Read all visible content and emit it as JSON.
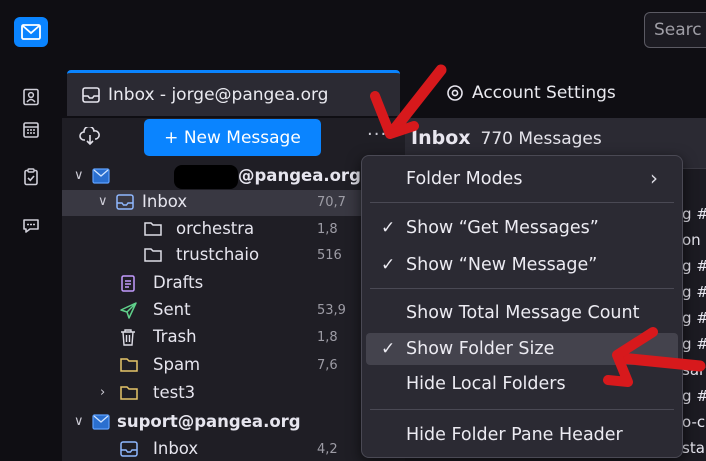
{
  "search": {
    "placeholder": "Searc"
  },
  "tabs": [
    {
      "label": "Inbox - jorge@pangea.org",
      "icon": "inbox-icon"
    },
    {
      "label": "Account Settings",
      "icon": "settings-gear-icon"
    }
  ],
  "folder_pane": {
    "new_message_label": "+ New Message",
    "menu_label": "···",
    "accounts": [
      {
        "name": "@pangea.org"
      },
      {
        "name": "suport@pangea.org"
      }
    ],
    "folders": [
      {
        "name": "Inbox",
        "size": "70,7"
      },
      {
        "name": "orchestra",
        "size": "1,8"
      },
      {
        "name": "trustchaio",
        "size": "516"
      },
      {
        "name": "Drafts",
        "size": ""
      },
      {
        "name": "Sent",
        "size": "53,9"
      },
      {
        "name": "Trash",
        "size": "1,8"
      },
      {
        "name": "Spam",
        "size": "7,6"
      },
      {
        "name": "test3",
        "size": ""
      },
      {
        "name": "Inbox",
        "size": "4,2"
      }
    ]
  },
  "message_pane": {
    "title": "Inbox",
    "count": "770 Messages",
    "fragments": [
      "g #",
      "on",
      "g #",
      "g #",
      "g #",
      "g #",
      "sar",
      "g #",
      "o-c",
      "sta"
    ]
  },
  "popup_menu": {
    "items": [
      {
        "label": "Folder Modes",
        "checked": false,
        "submenu": true
      },
      {
        "label": "Show “Get Messages”",
        "checked": true
      },
      {
        "label": "Show “New Message”",
        "checked": true
      },
      {
        "label": "Show Total Message Count",
        "checked": false
      },
      {
        "label": "Show Folder Size",
        "checked": true
      },
      {
        "label": "Hide Local Folders",
        "checked": false
      },
      {
        "label": "Hide Folder Pane Header",
        "checked": false
      }
    ],
    "check_glyph": "✓",
    "submenu_glyph": "›"
  },
  "colors": {
    "accent": "#0a84ff",
    "annotation": "#d7191c"
  }
}
